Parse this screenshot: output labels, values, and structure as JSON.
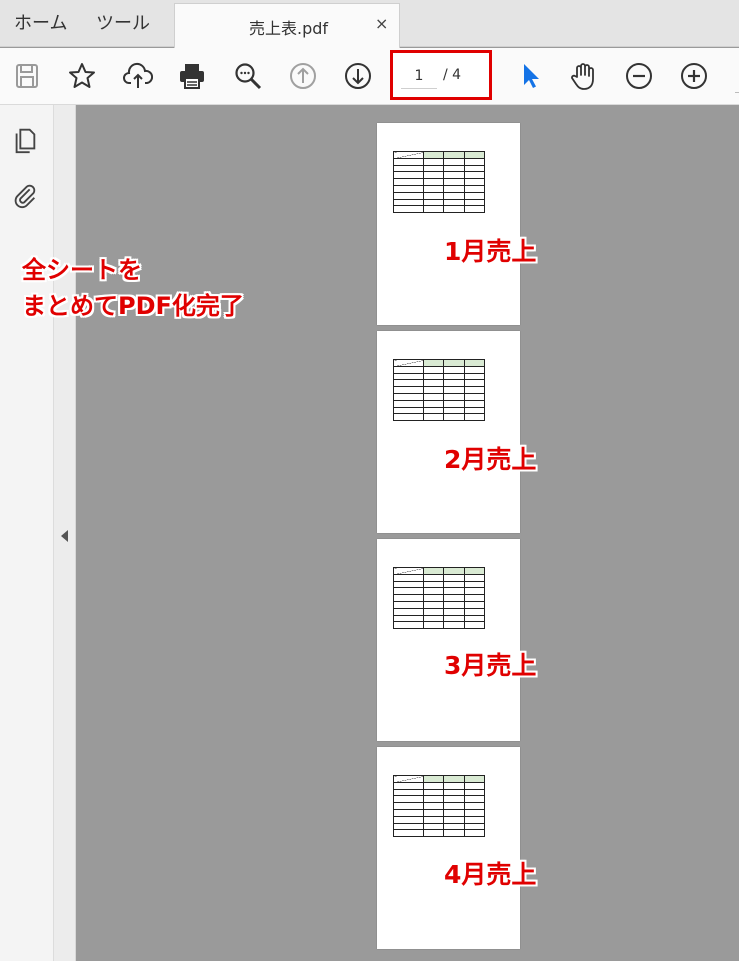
{
  "tabs": {
    "home": "ホーム",
    "tools": "ツール",
    "document": "売上表.pdf",
    "close": "×"
  },
  "toolbar": {
    "icons": [
      "save-icon",
      "bookmark-star-icon",
      "cloud-upload-icon",
      "print-icon",
      "zoom-search-icon",
      "page-up-icon",
      "page-down-icon",
      "select-cursor-icon",
      "hand-tool-icon",
      "zoom-out-icon",
      "zoom-in-icon"
    ],
    "current_page": "1",
    "total_pages": "/ 4"
  },
  "leftnav": {
    "icons": [
      "page-thumbnails-icon",
      "attachments-icon"
    ]
  },
  "annotation": {
    "line1": "全シートを",
    "line2": "まとめてPDF化完了"
  },
  "colors": {
    "annotation_red": "#e00000",
    "highlight_box": "#e00000",
    "select_blue": "#1473e6",
    "viewer_gray": "#9a9a9a",
    "table_header_green": "#d9ead3"
  },
  "pages": [
    {
      "label": "1月売上"
    },
    {
      "label": "2月売上"
    },
    {
      "label": "3月売上"
    },
    {
      "label": "4月売上"
    }
  ]
}
